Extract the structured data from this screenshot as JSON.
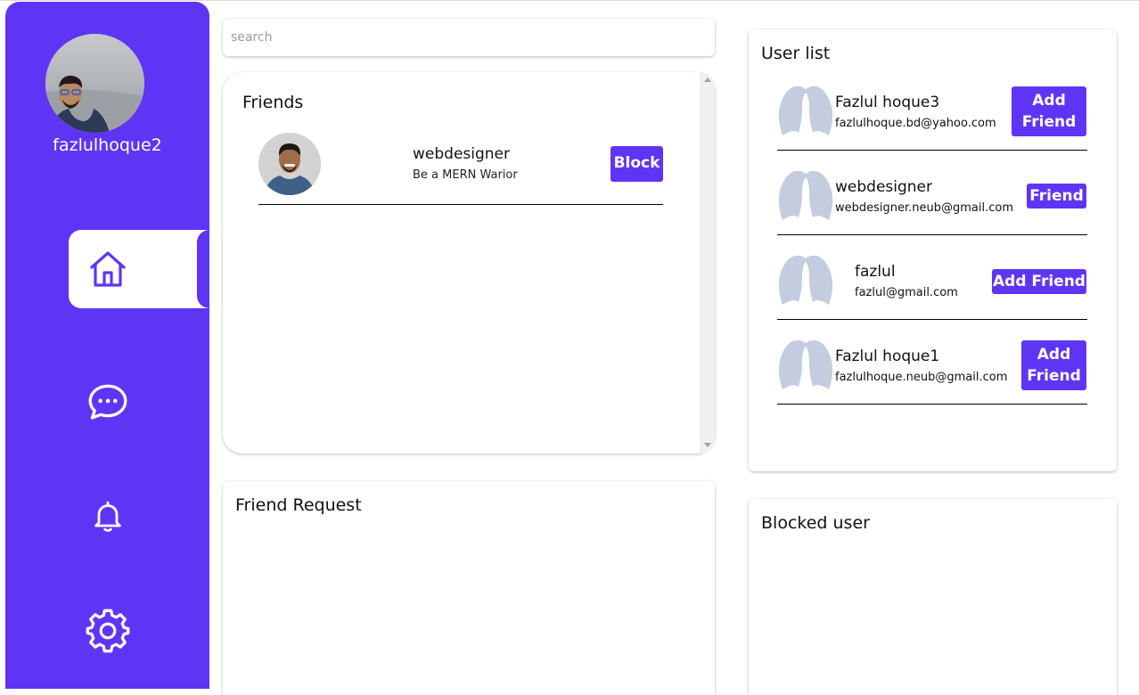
{
  "sidebar": {
    "username": "fazlulhoque2",
    "nav": [
      "home-icon",
      "message-icon",
      "bell-icon",
      "gear-icon"
    ],
    "accent": "#5f35f5"
  },
  "search": {
    "placeholder": "search",
    "value": ""
  },
  "friends": {
    "title": "Friends",
    "items": [
      {
        "name": "webdesigner",
        "subtitle": "Be a MERN Warior",
        "action": "Block"
      }
    ]
  },
  "friend_request": {
    "title": "Friend Request"
  },
  "user_list": {
    "title": "User list",
    "items": [
      {
        "name": "Fazlul hoque3",
        "email": "fazlulhoque.bd@yahoo.com",
        "action_line1": "Add",
        "action_line2": "Friend"
      },
      {
        "name": "webdesigner",
        "email": "webdesigner.neub@gmail.com",
        "action": "Friend"
      },
      {
        "name": "fazlul",
        "email": "fazlul@gmail.com",
        "action": "Add Friend"
      },
      {
        "name": "Fazlul hoque1",
        "email": "fazlulhoque.neub@gmail.com",
        "action_line1": "Add",
        "action_line2": "Friend"
      }
    ]
  },
  "blocked_users": {
    "title": "Blocked user"
  }
}
